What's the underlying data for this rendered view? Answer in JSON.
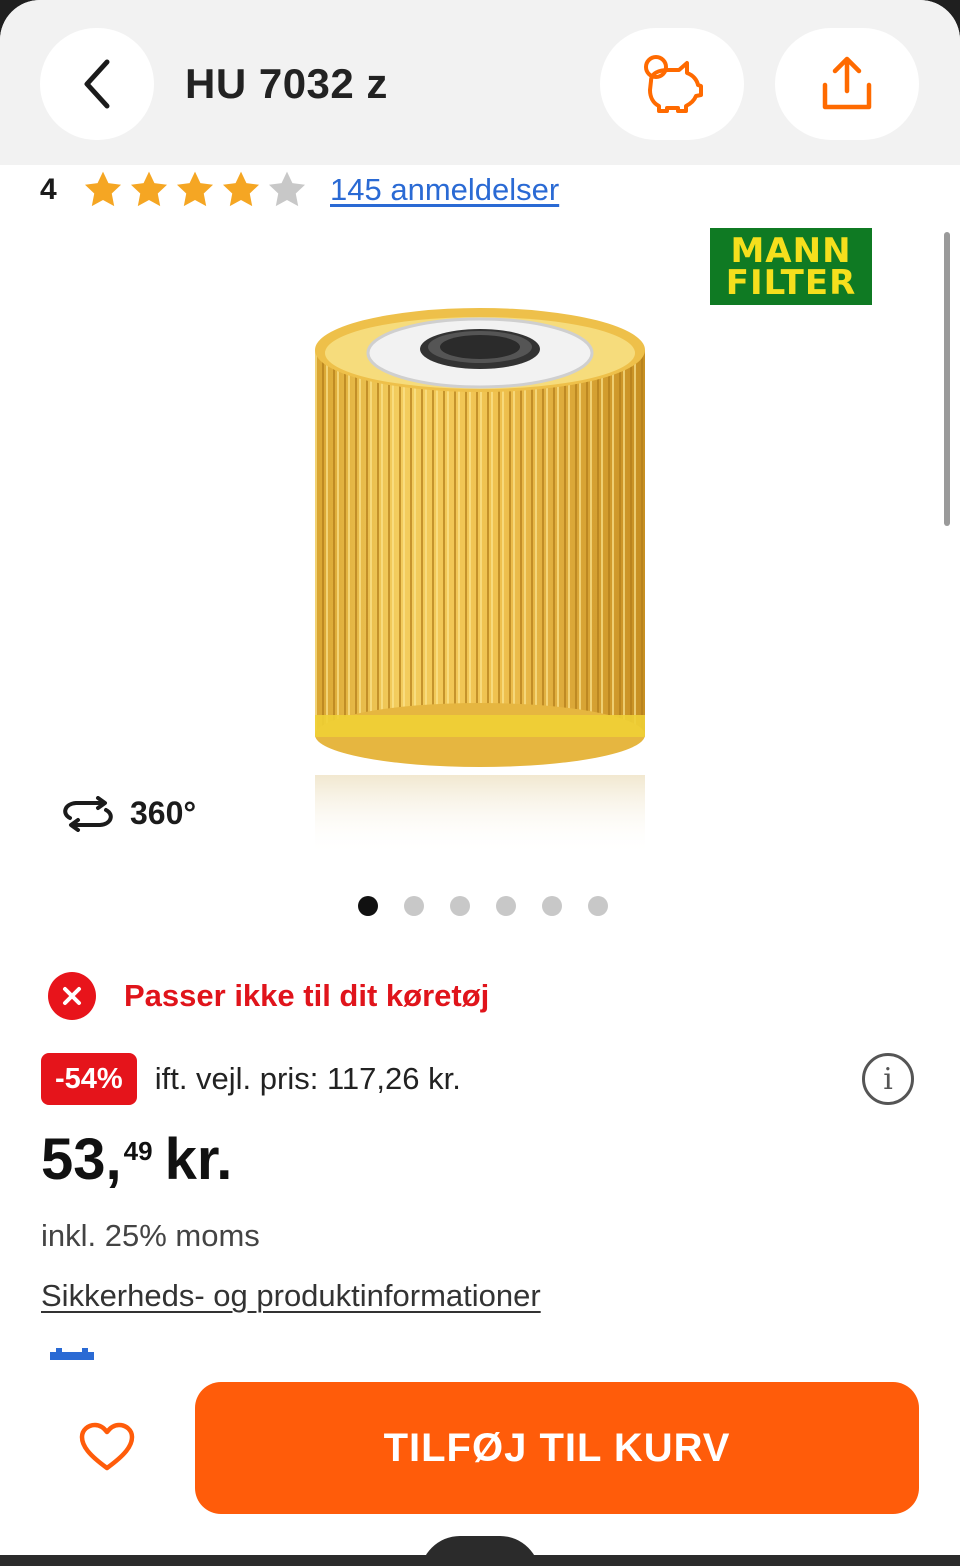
{
  "header": {
    "title": "HU 7032 z",
    "back_icon": "chevron-left-icon",
    "savings_icon": "piggy-bank-icon",
    "share_icon": "share-icon"
  },
  "rating": {
    "value": "4",
    "stars_filled": 4,
    "stars_total": 5,
    "reviews_label": "145 anmeldelser"
  },
  "brand": {
    "line1": "MANN",
    "line2": "FILTER"
  },
  "gallery": {
    "rotate_label": "360°",
    "image_count": 6,
    "active_index": 0
  },
  "fitment": {
    "text": "Passer ikke til dit køretøj"
  },
  "pricing": {
    "discount_badge": "-54%",
    "rrp_text": "ift. vejl. pris: 117,26 kr.",
    "price_main": "53,",
    "price_cents": "49",
    "currency": "kr.",
    "vat_text": "inkl. 25% moms",
    "safety_link": "Sikkerheds- og produktinformationer"
  },
  "actions": {
    "add_to_cart": "TILFØJ TIL KURV"
  },
  "colors": {
    "accent": "#ff5c0a",
    "error": "#e5141b",
    "star": "#f5a623",
    "link": "#2a6ad4",
    "brand_green": "#0f7a23",
    "brand_yellow": "#f5df1d"
  }
}
